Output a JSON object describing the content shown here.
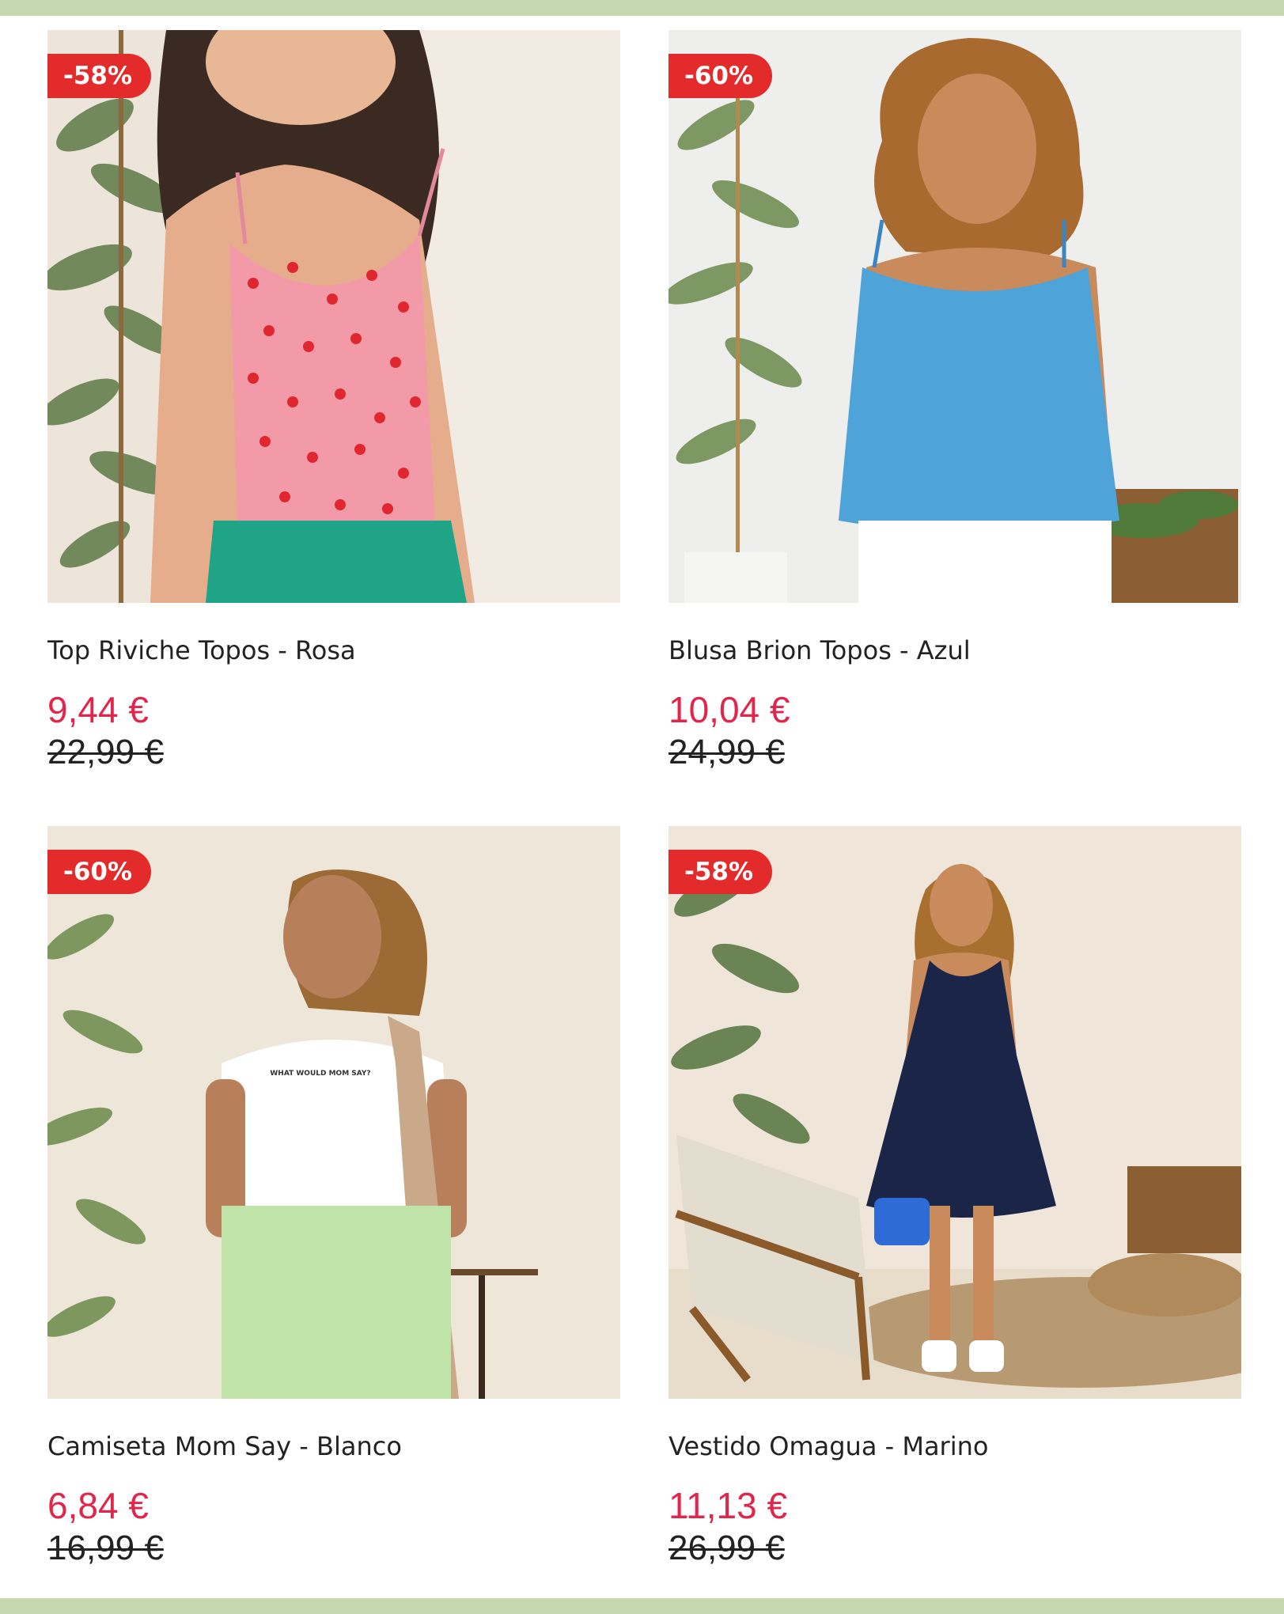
{
  "colors": {
    "frame_band": "#c5d8b0",
    "badge_bg": "#e42b2b",
    "price_sale": "#e0264a",
    "text": "#222222"
  },
  "products": [
    {
      "name": "Top Riviche Topos - Rosa",
      "price": "9,44 €",
      "old_price": "22,99 €",
      "discount": "-58%",
      "image": "woman-pink-polka-dot-camisole"
    },
    {
      "name": "Blusa Brion Topos - Azul",
      "price": "10,04 €",
      "old_price": "24,99 €",
      "discount": "-60%",
      "image": "woman-blue-babydoll-top"
    },
    {
      "name": "Camiseta Mom Say - Blanco",
      "price": "6,84 €",
      "old_price": "16,99 €",
      "discount": "-60%",
      "image": "woman-white-tshirt-green-pants",
      "shirt_print": "WHAT WOULD MOM SAY?"
    },
    {
      "name": "Vestido Omagua - Marino",
      "price": "11,13 €",
      "old_price": "26,99 €",
      "discount": "-58%",
      "image": "woman-navy-halter-dress"
    }
  ]
}
